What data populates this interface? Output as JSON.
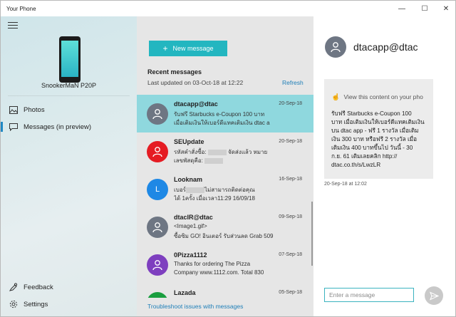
{
  "window": {
    "title": "Your Phone"
  },
  "window_controls": {
    "minimize": "—",
    "maximize": "☐",
    "close": "✕"
  },
  "left": {
    "phone_name": "SnookerMaN P20P",
    "nav": [
      {
        "label": "Photos",
        "icon": "photo-icon"
      },
      {
        "label": "Messages (in preview)",
        "icon": "message-icon"
      }
    ],
    "footer": [
      {
        "label": "Feedback",
        "icon": "feedback-icon"
      },
      {
        "label": "Settings",
        "icon": "gear-icon"
      }
    ]
  },
  "middle": {
    "new_message_label": "New message",
    "recent_title": "Recent messages",
    "updated": "Last updated on 03-Oct-18 at 12:22",
    "refresh": "Refresh",
    "troubleshoot": "Troubleshoot issues with messages",
    "threads": [
      {
        "name": "dtacapp@dtac",
        "date": "20-Sep-18",
        "line1": "รับฟรี Starbucks e-Coupon 100 บาท",
        "line2": "เมื่อเติมเงินให้เบอร์ดีแทคเติมเงิน dtac a",
        "avatar": "person",
        "color": "#6e7683"
      },
      {
        "name": "SEUpdate",
        "date": "20-Sep-18",
        "line1": "รหัสคำสั่งซื้อ:",
        "line1b": "จัดส่งแล้ว หมาย",
        "line2": "เลขพัสดุคือ:",
        "avatar": "person",
        "color": "#e51c23"
      },
      {
        "name": "Looknam",
        "date": "16-Sep-18",
        "line1": "เบอร์",
        "line1b": "ไม่สามารถติดต่อคุณ",
        "line2": "ได้ 1ครั้ง เมื่อเวลา11:29 16/09/18",
        "avatar": "L",
        "color": "#1e88e5"
      },
      {
        "name": "dtacIR@dtac",
        "date": "09-Sep-18",
        "line1": "<Image1.gif>",
        "line2": "ซื้อซิม GO! อินเตอร์ รับส่วนลด Grab 509",
        "avatar": "person",
        "color": "#6e7683"
      },
      {
        "name": "0Pizza1112",
        "date": "07-Sep-18",
        "line1": "Thanks for ordering The Pizza",
        "line2": "Company www.1112.com. Total 830",
        "avatar": "person",
        "color": "#7e3fbf"
      },
      {
        "name": "Lazada",
        "date": "05-Sep-18",
        "line1": "",
        "line2": "",
        "avatar": "person",
        "color": "#1a9e3f"
      }
    ]
  },
  "right": {
    "contact_name": "dtacapp@dtac",
    "view_content": "View this content on your pho",
    "message_lines": [
      "รับฟรี Starbucks e-Coupon 100",
      "บาท เมื่อเติมเงินให้เบอร์ดีแทคเติมเงิน",
      "บน dtac app - ฟรี 1 รางวัล เมื่อเติม",
      "เงิน 300 บาท หรือฟรี 2 รางวัล เมื่อ",
      "เติมเงิน 400 บาทขึ้นไป วันนี้ - 30",
      "ก.ย. 61 เติมเลยคลิก http://",
      "dtac.co.th/s/LwzLR"
    ],
    "message_time": "20-Sep-18 at 12:02",
    "compose_placeholder": "Enter a message"
  }
}
